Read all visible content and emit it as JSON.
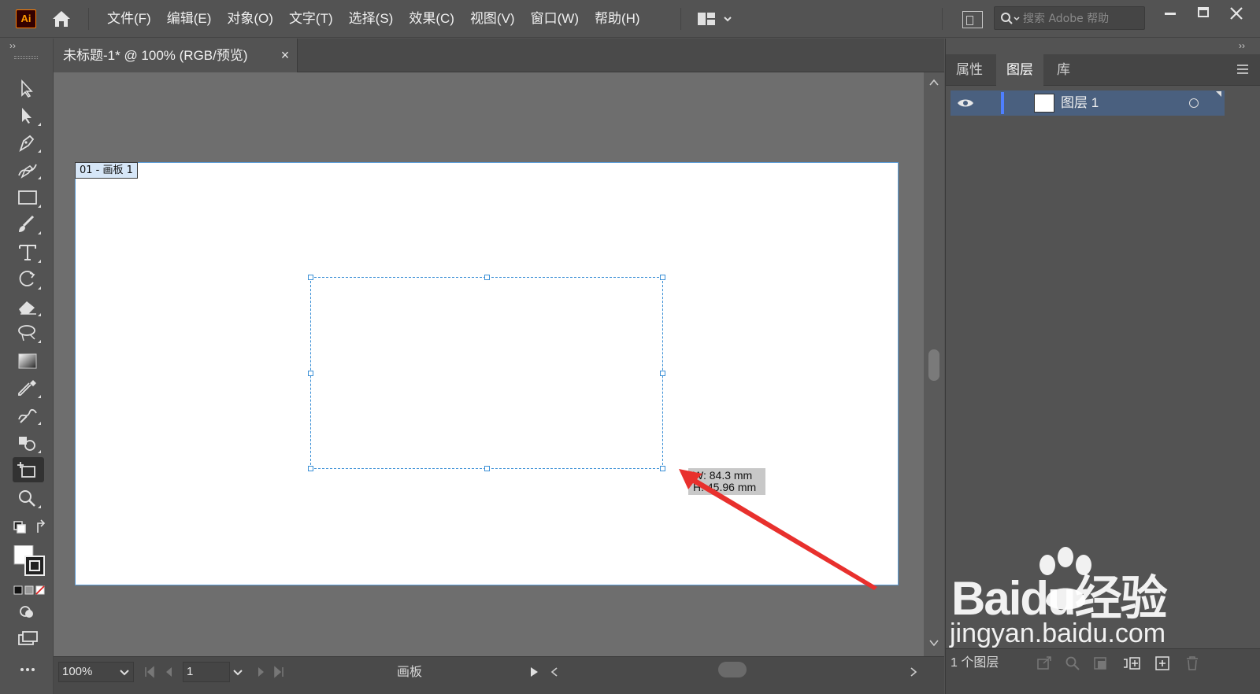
{
  "app": {
    "logo_text": "Ai",
    "menu": [
      "文件(F)",
      "编辑(E)",
      "对象(O)",
      "文字(T)",
      "选择(S)",
      "效果(C)",
      "视图(V)",
      "窗口(W)",
      "帮助(H)"
    ],
    "search_placeholder": "搜索 Adobe 帮助"
  },
  "document": {
    "tab_title": "未标题-1* @ 100% (RGB/预览)",
    "close_glyph": "×"
  },
  "canvas": {
    "artboard_label": "01 - 画板 1",
    "tooltip_width": "W: 84.3 mm",
    "tooltip_height": "H: 45.96 mm"
  },
  "status": {
    "zoom": "100%",
    "page": "1",
    "label": "画板"
  },
  "panel": {
    "collapse_glyph": "››",
    "tabs": [
      "属性",
      "图层",
      "库"
    ],
    "active_tab": "图层",
    "layer_name": "图层 1",
    "layer_count": "1 个图层"
  },
  "toolbar": {
    "collapse_glyph": "››"
  },
  "watermark": {
    "brand": "Baidu经验",
    "url": "jingyan.baidu.com"
  },
  "colors": {
    "accent_selection": "#3a8fd6",
    "layer_color": "#4e7fff",
    "annotation_arrow": "#e8302d"
  }
}
